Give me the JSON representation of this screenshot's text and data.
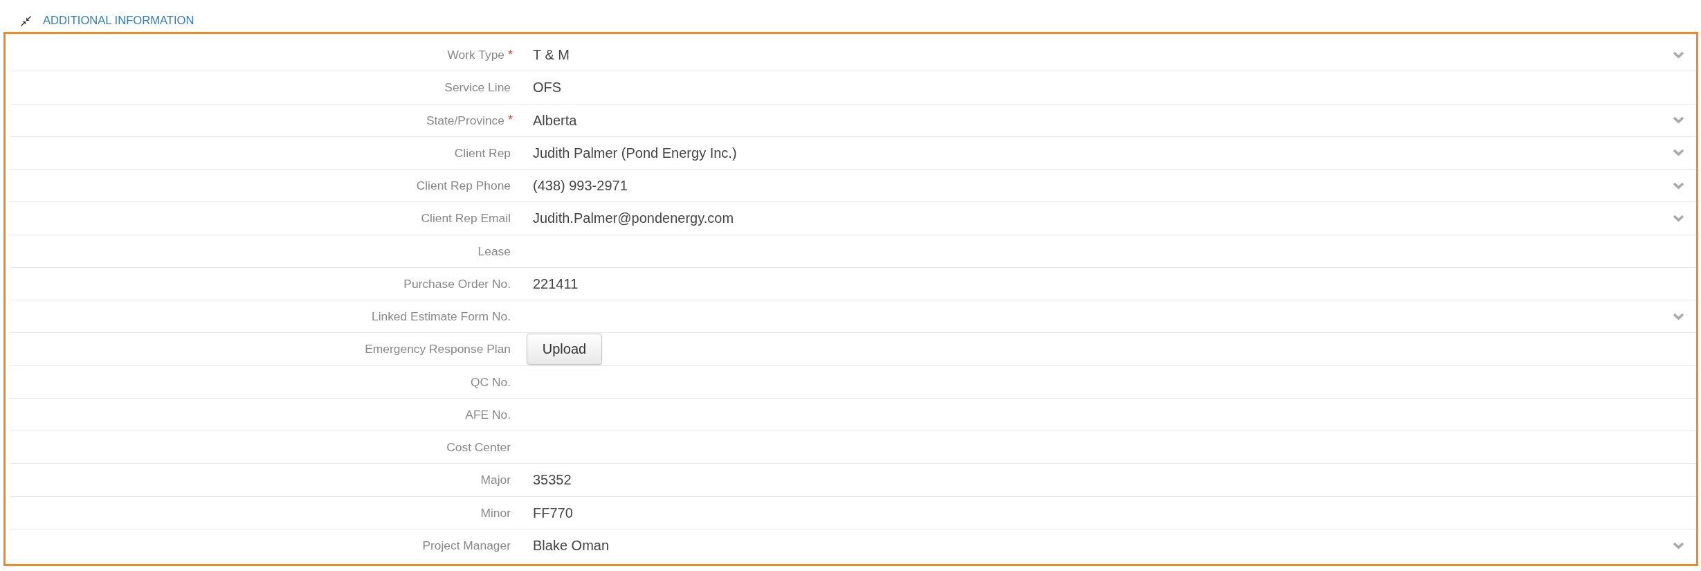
{
  "section": {
    "title": "ADDITIONAL INFORMATION",
    "expanded": true
  },
  "fields": [
    {
      "label": "Work Type",
      "required_mark": "*",
      "kind": "select",
      "value": "T & M"
    },
    {
      "label": "Service Line",
      "kind": "text",
      "value": "OFS"
    },
    {
      "label": "State/Province",
      "required_mark": "*",
      "kind": "select",
      "value": "Alberta"
    },
    {
      "label": "Client Rep",
      "kind": "select",
      "value": "Judith Palmer (Pond Energy Inc.)"
    },
    {
      "label": "Client Rep Phone",
      "kind": "select",
      "value": "(438) 993-2971"
    },
    {
      "label": "Client Rep Email",
      "kind": "select",
      "value": "Judith.Palmer@pondenergy.com"
    },
    {
      "label": "Lease",
      "kind": "text"
    },
    {
      "label": "Purchase Order No.",
      "kind": "text",
      "value": "221411"
    },
    {
      "label": "Linked Estimate Form No.",
      "kind": "select"
    },
    {
      "label": "Emergency Response Plan",
      "kind": "upload",
      "button": "Upload"
    },
    {
      "label": "QC No.",
      "kind": "text"
    },
    {
      "label": "AFE No.",
      "kind": "text"
    },
    {
      "label": "Cost Center",
      "kind": "text"
    },
    {
      "label": "Major",
      "kind": "text",
      "value": "35352"
    },
    {
      "label": "Minor",
      "kind": "text",
      "value": "FF770"
    },
    {
      "label": "Project Manager",
      "kind": "select",
      "value": "Blake Oman"
    }
  ]
}
